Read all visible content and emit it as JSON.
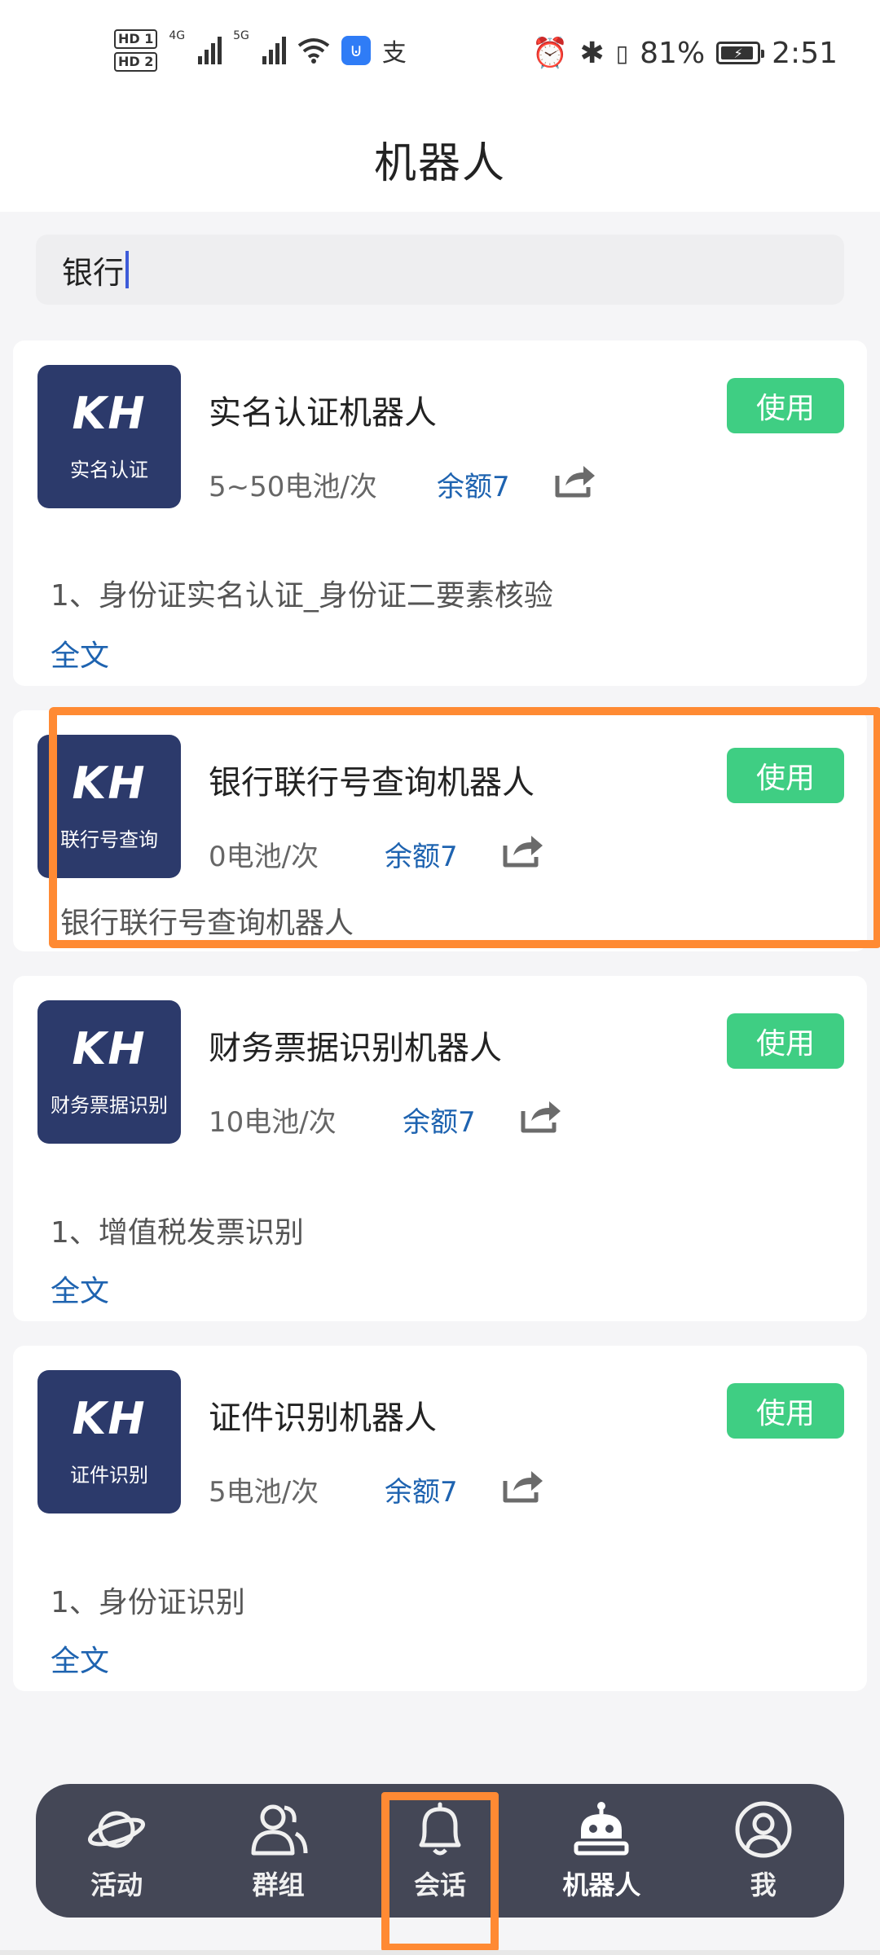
{
  "status_bar": {
    "hd1": "HD 1",
    "hd2": "HD 2",
    "net1": "4G",
    "net2": "5G",
    "alipay_glyph": "支",
    "battery_percent": "81%",
    "time": "2:51",
    "icons": [
      "signal-icon",
      "wifi-icon",
      "app-badge-icon",
      "alarm-icon",
      "bluetooth-icon",
      "vibrate-icon",
      "battery-icon"
    ]
  },
  "header": {
    "title": "机器人"
  },
  "search": {
    "value": "银行"
  },
  "robots": [
    {
      "logo_mark": "KH",
      "logo_text": "实名认证",
      "name": "实名认证机器人",
      "price": "5~50电池/次",
      "quota": "余额7",
      "use_label": "使用",
      "description": "1、身份证实名认证_身份证二要素核验",
      "fulltext_label": "全文"
    },
    {
      "logo_mark": "KH",
      "logo_text": "联行号查询",
      "name": "银行联行号查询机器人",
      "price": "0电池/次",
      "quota": "余额7",
      "use_label": "使用",
      "description": "银行联行号查询机器人"
    },
    {
      "logo_mark": "KH",
      "logo_text": "财务票据识别",
      "name": "财务票据识别机器人",
      "price": "10电池/次",
      "quota": "余额7",
      "use_label": "使用",
      "description": "1、增值税发票识别",
      "fulltext_label": "全文"
    },
    {
      "logo_mark": "KH",
      "logo_text": "证件识别",
      "name": "证件识别机器人",
      "price": "5电池/次",
      "quota": "余额7",
      "use_label": "使用",
      "description": "1、身份证识别",
      "fulltext_label": "全文"
    }
  ],
  "tabbar": {
    "tabs": [
      {
        "label": "活动",
        "icon": "planet-icon"
      },
      {
        "label": "群组",
        "icon": "group-icon"
      },
      {
        "label": "会话",
        "icon": "bell-icon"
      },
      {
        "label": "机器人",
        "icon": "robot-icon",
        "active": true
      },
      {
        "label": "我",
        "icon": "user-icon"
      }
    ]
  },
  "colors": {
    "accent_green": "#3fce83",
    "link_blue": "#1e63b0",
    "logo_navy": "#2c3a6b",
    "tabbar_bg": "#444756",
    "highlight_orange": "#ff8a33"
  }
}
